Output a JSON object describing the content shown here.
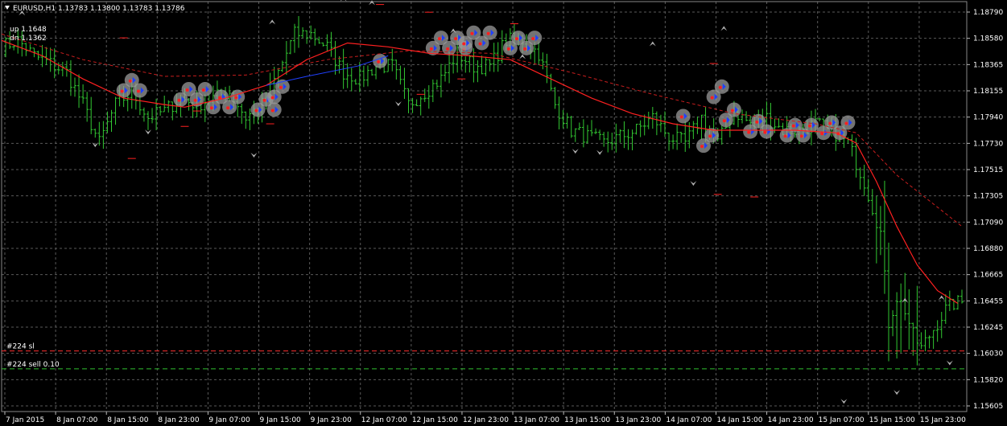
{
  "header": {
    "title": "EURUSD,H1  1.13783 1.13800 1.13783 1.13786"
  },
  "indicator": {
    "up": "up 1.1648",
    "dn": "dn 1.1362"
  },
  "order_lines": [
    {
      "label": "#224 sl",
      "price": 1.1608,
      "color": "#ff3030"
    },
    {
      "label": "#224 sell 0.10",
      "price": 1.1594,
      "color": "#30c030"
    }
  ],
  "colors": {
    "background": "#000000",
    "grid": "#5a5a5a",
    "bar": "#32c832",
    "ma_fast": "#ff2020",
    "ma_slow": "#c81e1e",
    "ma_blue": "#2040ff",
    "axis_text": "#ffffff",
    "dot_ring": "#9a9a9a"
  },
  "chart_data": {
    "type": "ohlc",
    "symbol": "EURUSD",
    "timeframe": "H1",
    "ylim": [
      1.1562,
      1.1879
    ],
    "y_ticks": [
      "1.18790",
      "1.18580",
      "1.18365",
      "1.18155",
      "1.17940",
      "1.17730",
      "1.17515",
      "1.17305",
      "1.17090",
      "1.16880",
      "1.16665",
      "1.16455",
      "1.16245",
      "1.16030",
      "1.15820",
      "1.15605"
    ],
    "x_ticks": [
      "7 Jan 2015",
      "8 Jan 07:00",
      "8 Jan 15:00",
      "8 Jan 23:00",
      "9 Jan 07:00",
      "9 Jan 15:00",
      "9 Jan 23:00",
      "12 Jan 07:00",
      "12 Jan 15:00",
      "12 Jan 23:00",
      "13 Jan 07:00",
      "13 Jan 15:00",
      "13 Jan 23:00",
      "14 Jan 07:00",
      "14 Jan 15:00",
      "14 Jan 23:00",
      "15 Jan 07:00",
      "15 Jan 15:00",
      "15 Jan 23:00"
    ],
    "close_path": [
      [
        0,
        1.1845
      ],
      [
        8,
        1.185
      ],
      [
        16,
        1.1838
      ],
      [
        24,
        1.1832
      ],
      [
        32,
        1.1825
      ],
      [
        40,
        1.18
      ],
      [
        48,
        1.177
      ],
      [
        56,
        1.18
      ],
      [
        64,
        1.181
      ],
      [
        72,
        1.179
      ],
      [
        80,
        1.1795
      ],
      [
        88,
        1.1805
      ],
      [
        96,
        1.18
      ],
      [
        104,
        1.1805
      ],
      [
        112,
        1.181
      ],
      [
        120,
        1.179
      ],
      [
        128,
        1.18
      ],
      [
        136,
        1.1825
      ],
      [
        144,
        1.1855
      ],
      [
        152,
        1.1855
      ],
      [
        160,
        1.1845
      ],
      [
        168,
        1.1825
      ],
      [
        176,
        1.182
      ],
      [
        184,
        1.183
      ],
      [
        192,
        1.183
      ],
      [
        200,
        1.18
      ],
      [
        208,
        1.181
      ],
      [
        216,
        1.182
      ],
      [
        224,
        1.184
      ],
      [
        232,
        1.183
      ],
      [
        240,
        1.183
      ],
      [
        248,
        1.185
      ],
      [
        256,
        1.185
      ],
      [
        264,
        1.184
      ],
      [
        272,
        1.18
      ],
      [
        280,
        1.178
      ],
      [
        288,
        1.1775
      ],
      [
        296,
        1.177
      ],
      [
        304,
        1.1775
      ],
      [
        312,
        1.178
      ],
      [
        320,
        1.179
      ],
      [
        328,
        1.1775
      ],
      [
        336,
        1.177
      ],
      [
        344,
        1.179
      ],
      [
        352,
        1.177
      ],
      [
        360,
        1.1795
      ],
      [
        368,
        1.1785
      ],
      [
        376,
        1.179
      ],
      [
        384,
        1.178
      ],
      [
        392,
        1.178
      ],
      [
        400,
        1.1785
      ],
      [
        408,
        1.178
      ],
      [
        416,
        1.177
      ],
      [
        424,
        1.174
      ],
      [
        432,
        1.17
      ],
      [
        436,
        1.163
      ],
      [
        440,
        1.165
      ],
      [
        444,
        1.164
      ],
      [
        448,
        1.162
      ],
      [
        452,
        1.161
      ],
      [
        456,
        1.162
      ],
      [
        460,
        1.163
      ],
      [
        464,
        1.164
      ],
      [
        468,
        1.1645
      ],
      [
        472,
        1.1646
      ]
    ],
    "ma_fast": [
      [
        0,
        1.185
      ],
      [
        20,
        1.1838
      ],
      [
        40,
        1.182
      ],
      [
        60,
        1.1805
      ],
      [
        80,
        1.18
      ],
      [
        90,
        1.1798
      ],
      [
        110,
        1.1805
      ],
      [
        130,
        1.1815
      ],
      [
        150,
        1.1835
      ],
      [
        170,
        1.1848
      ],
      [
        190,
        1.1845
      ],
      [
        210,
        1.184
      ],
      [
        230,
        1.1838
      ],
      [
        250,
        1.1835
      ],
      [
        270,
        1.182
      ],
      [
        290,
        1.1805
      ],
      [
        310,
        1.1793
      ],
      [
        330,
        1.1785
      ],
      [
        350,
        1.178
      ],
      [
        370,
        1.178
      ],
      [
        390,
        1.178
      ],
      [
        410,
        1.1778
      ],
      [
        420,
        1.177
      ],
      [
        430,
        1.174
      ],
      [
        440,
        1.1705
      ],
      [
        450,
        1.1675
      ],
      [
        460,
        1.1655
      ],
      [
        470,
        1.1645
      ]
    ],
    "ma_slow": [
      [
        0,
        1.1855
      ],
      [
        40,
        1.1835
      ],
      [
        80,
        1.1822
      ],
      [
        120,
        1.1823
      ],
      [
        160,
        1.1835
      ],
      [
        200,
        1.1842
      ],
      [
        240,
        1.184
      ],
      [
        280,
        1.1825
      ],
      [
        320,
        1.1808
      ],
      [
        360,
        1.1793
      ],
      [
        400,
        1.1785
      ],
      [
        420,
        1.1778
      ],
      [
        440,
        1.1745
      ],
      [
        460,
        1.172
      ],
      [
        472,
        1.1705
      ]
    ]
  }
}
